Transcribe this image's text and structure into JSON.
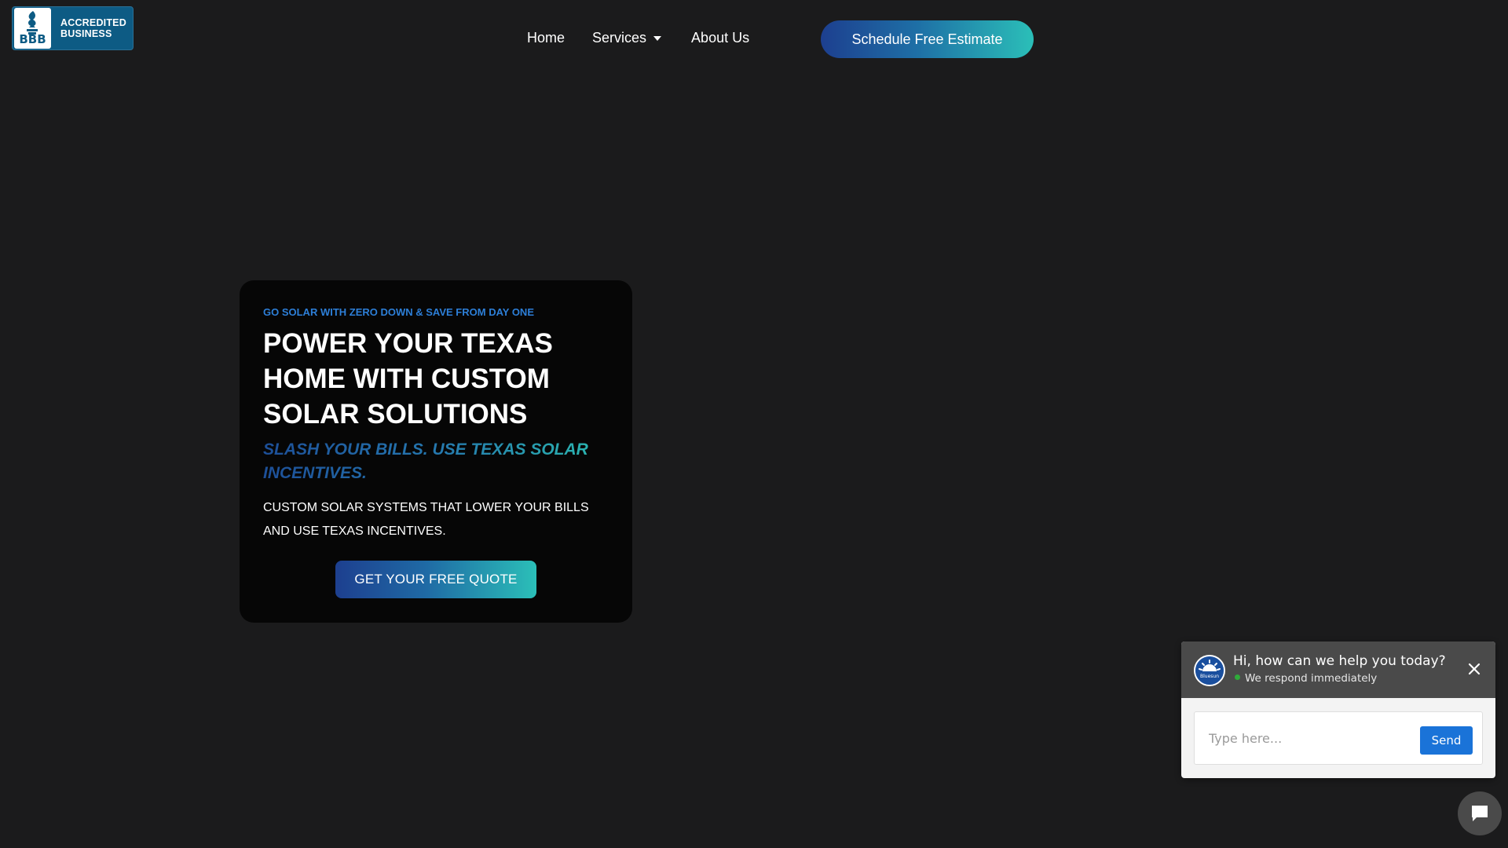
{
  "header": {
    "bbb_badge": {
      "letters": "BBB",
      "line1": "ACCREDITED",
      "line2": "BUSINESS"
    },
    "nav": [
      {
        "label": "Home"
      },
      {
        "label": "Services",
        "has_dropdown": true
      },
      {
        "label": "About Us"
      }
    ],
    "cta_label": "Schedule Free Estimate"
  },
  "hero": {
    "eyebrow": "GO SOLAR WITH ZERO DOWN & SAVE FROM DAY ONE",
    "title": "POWER YOUR TEXAS HOME WITH CUSTOM SOLAR SOLUTIONS",
    "subtitle": "SLASH YOUR BILLS. USE TEXAS SOLAR INCENTIVES.",
    "description": "CUSTOM SOLAR SYSTEMS THAT LOWER YOUR BILLS AND USE TEXAS INCENTIVES.",
    "button_label": "GET YOUR FREE QUOTE"
  },
  "chat": {
    "avatar_text": "Bluesun",
    "title": "Hi, how can we help you today?",
    "status": "We respond immediately",
    "input_placeholder": "Type here...",
    "send_label": "Send"
  },
  "colors": {
    "background": "#1b1b1c",
    "card": "#060606",
    "accent_blue": "#1d3f8f",
    "accent_teal": "#2bbfb8",
    "eyebrow": "#2d7fd8",
    "chat_header": "#4a4a4a",
    "send_button": "#1a73d8",
    "online": "#2faa3a"
  },
  "icons": {
    "services_dropdown": "caret-down-icon",
    "chat_close": "close-icon",
    "chat_launcher": "chat-bubble-icon"
  }
}
